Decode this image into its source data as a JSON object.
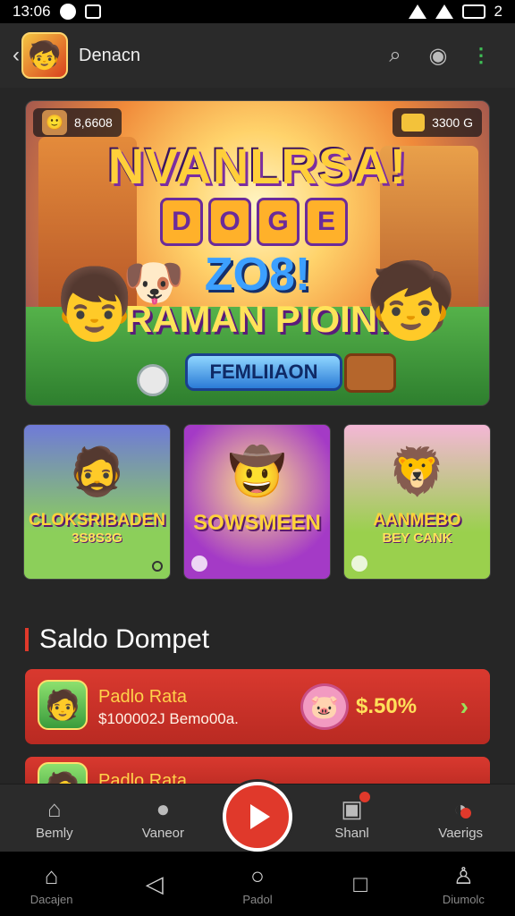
{
  "status_bar": {
    "time": "13:06",
    "battery": "2"
  },
  "app_bar": {
    "title": "Denacn",
    "avatar_icon": "boy-mascot-icon",
    "back_icon": "chevron-left-icon"
  },
  "hero": {
    "badge_left": "8,6608",
    "badge_right": "3300 G",
    "title_line1": "NVANLRSA!",
    "tiles": [
      "D",
      "O",
      "G",
      "E"
    ],
    "title_line2": "ZO8!",
    "title_line3": "RAMAN PIOIN!",
    "cta_label": "FEMLIIAON"
  },
  "games": [
    {
      "name": "CLOKSRIBADEN",
      "sub": "3S8S3G"
    },
    {
      "name": "SOWSMEEN",
      "sub": ""
    },
    {
      "name": "AANMEBO",
      "sub": "BEY CANK"
    }
  ],
  "section": {
    "title": "Saldo Dompet"
  },
  "wallet": [
    {
      "title": "Padlo Rata",
      "subtitle": "$100002J Bemo00a.",
      "amount": "$.50%"
    },
    {
      "title": "Padlo Rata",
      "subtitle": "",
      "amount": ""
    }
  ],
  "bottom_nav": [
    {
      "label": "Bemly",
      "icon": "home-icon"
    },
    {
      "label": "Vaneor",
      "icon": "user-icon"
    },
    {
      "label": "Shanl",
      "icon": "gift-icon"
    },
    {
      "label": "Vaerigs",
      "icon": "gauge-icon"
    }
  ],
  "system_nav": [
    {
      "label": "Dacajen",
      "icon": "home-outline-icon"
    },
    {
      "label": "",
      "icon": "back-triangle-icon"
    },
    {
      "label": "Padol",
      "icon": "home-circle-icon"
    },
    {
      "label": "",
      "icon": "recents-square-icon"
    },
    {
      "label": "Diumolc",
      "icon": "person-icon"
    }
  ],
  "colors": {
    "accent": "#e0392b",
    "wallet_bg": "#d9392f",
    "green_dot": "#3fbf56"
  }
}
